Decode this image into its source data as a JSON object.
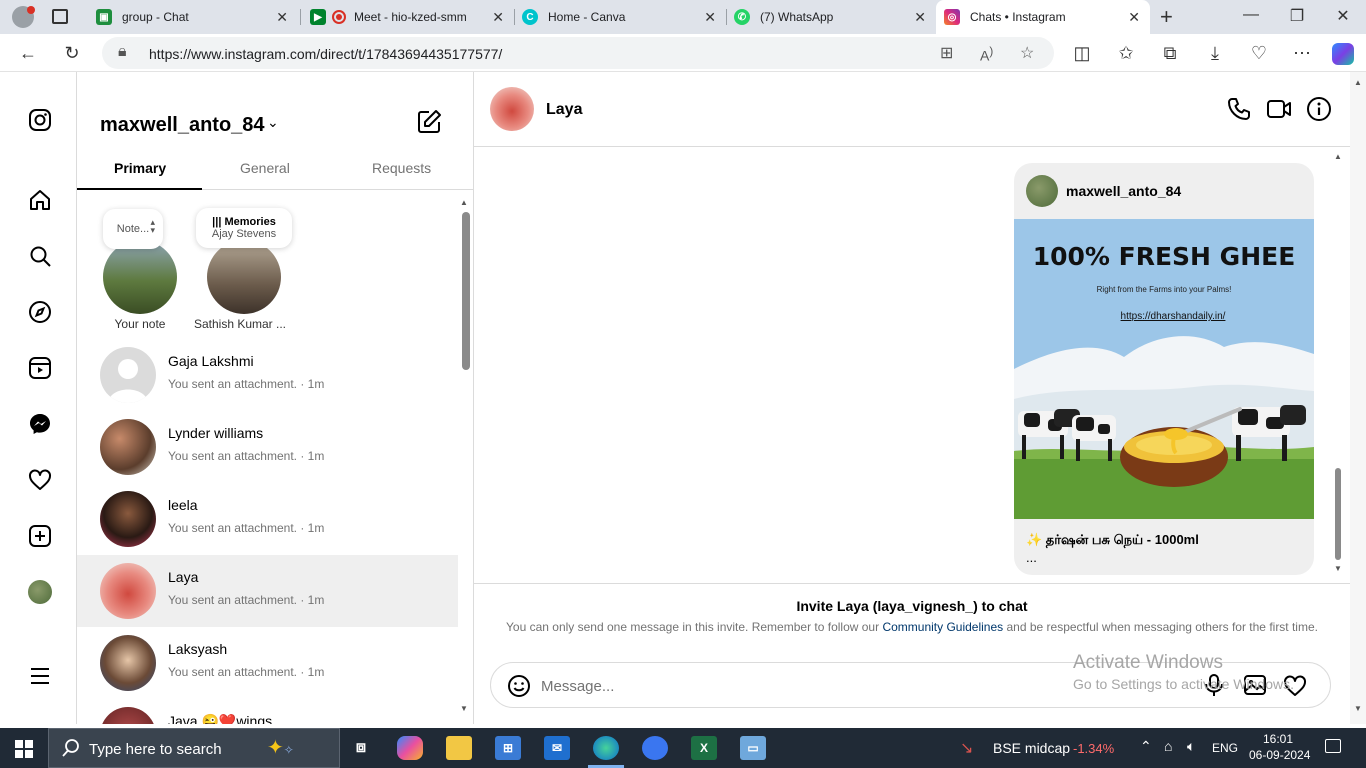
{
  "browser": {
    "tabs": [
      {
        "label": "group - Chat",
        "icon": "google-chat-icon",
        "color": "#1e8e3e"
      },
      {
        "label": "Meet - hio-kzed-smm",
        "icon": "google-meet-icon",
        "color": "#d93025"
      },
      {
        "label": "Home - Canva",
        "icon": "canva-icon",
        "color": "#00c4cc"
      },
      {
        "label": "(7) WhatsApp",
        "icon": "whatsapp-icon",
        "color": "#25d366"
      },
      {
        "label": "Chats • Instagram",
        "icon": "instagram-icon",
        "color": "#e1306c",
        "active": true
      }
    ],
    "url": "https://www.instagram.com/direct/t/17843694435177577/"
  },
  "inbox": {
    "account": "maxwell_anto_84",
    "tabs": [
      "Primary",
      "General",
      "Requests"
    ],
    "active_tab": "Primary",
    "notes": [
      {
        "bubble": "Note...",
        "label": "Your note"
      },
      {
        "bubble_title": "Memories",
        "bubble_sub": "Ajay Stevens",
        "label": "Sathish Kumar ..."
      }
    ],
    "conversations": [
      {
        "name": "Gaja Lakshmi",
        "preview": "You sent an attachment. · 1m"
      },
      {
        "name": "Lynder williams",
        "preview": "You sent an attachment. · 1m"
      },
      {
        "name": "leela",
        "preview": "You sent an attachment. · 1m"
      },
      {
        "name": "Laya",
        "preview": "You sent an attachment. · 1m",
        "active": true
      },
      {
        "name": "Laksyash",
        "preview": "You sent an attachment. · 1m"
      },
      {
        "name": "Java 😜❤️wings",
        "preview": ""
      }
    ]
  },
  "chat": {
    "contact": "Laya",
    "post": {
      "user": "maxwell_anto_84",
      "headline": "100% FRESH GHEE",
      "tagline": "Right from the Farms into your Palms!",
      "link": "https://dharshandaily.in/",
      "caption": "✨ தர்ஷன் பசு நெய் - 1000ml",
      "ellipsis": "..."
    },
    "invite": {
      "title": "Invite Laya (laya_vignesh_) to chat",
      "text_before": "You can only send one message in this invite. Remember to follow our ",
      "link": "Community Guidelines",
      "text_after": " and be respectful when messaging others for the first time."
    },
    "message_placeholder": "Message..."
  },
  "watermark": {
    "line1": "Activate Windows",
    "line2": "Go to Settings to activate Windows."
  },
  "taskbar": {
    "search_placeholder": "Type here to search",
    "stock_name": "BSE midcap",
    "stock_change": "-1.34%",
    "lang": "ENG",
    "time": "16:01",
    "date": "06-09-2024"
  }
}
